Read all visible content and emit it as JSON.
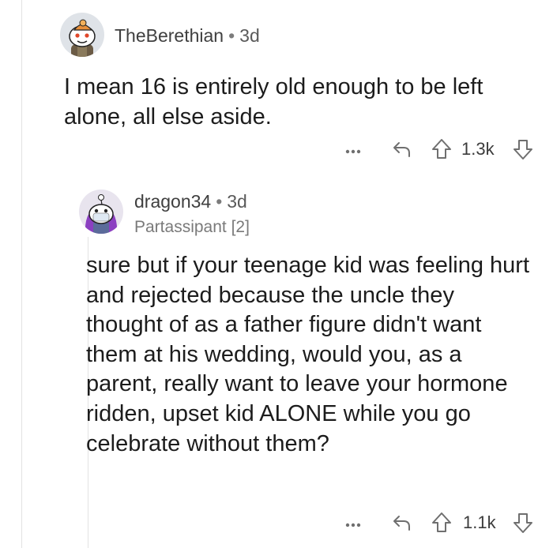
{
  "comments": [
    {
      "username": "TheBerethian",
      "age": "3d",
      "body": "I mean 16 is entirely old enough to be left alone, all else aside.",
      "votes": "1.3k"
    },
    {
      "username": "dragon34",
      "age": "3d",
      "flair": "Partassipant [2]",
      "body": "sure but if your teenage kid was feeling hurt and rejected because the uncle they thought of as a father figure didn't want them at his wedding, would you, as a parent, really want to leave your hormone ridden, upset kid ALONE while you go celebrate without them?",
      "votes": "1.1k"
    }
  ],
  "separator": "•",
  "more_label": "...",
  "icons": {
    "more": "more-options-icon",
    "reply": "reply-arrow-icon",
    "upvote": "upvote-arrow-icon",
    "downvote": "downvote-arrow-icon"
  },
  "colors": {
    "text": "#1c1c1c",
    "meta": "#7c7c7c",
    "icon": "#6f6f6f",
    "thread_line": "#e2e2e2",
    "avatar1_bg": "#dfe3e8",
    "avatar2_bg": "#e8e4ee",
    "avatar2_hair": "#8b3fc1"
  }
}
